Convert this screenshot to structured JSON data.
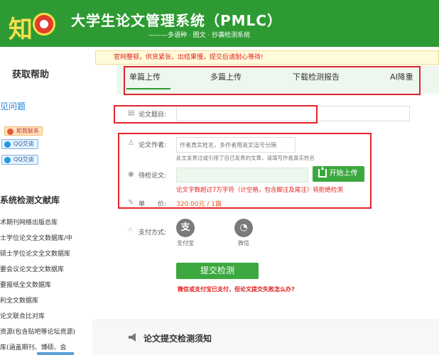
{
  "header": {
    "logo_text": "知",
    "title": "大学生论文管理系统（PMLC）",
    "subtitle": "———多语种 · 图文 · 抄袭检测系统"
  },
  "sidebar": {
    "help_title": "获取帮助",
    "faq_link": "见问题",
    "contact_badge": "和我联系",
    "qq_buttons": [
      "QQ交谈",
      "QQ交谈"
    ],
    "db_title": "系统检测文献库",
    "db_items": [
      "术期刊网络出版总库",
      "士学位论文全文数据库/中",
      "硕士学位论文全文数据库",
      "要会议论文全文数据库",
      "要报纸全文数据库",
      "利全文数据库",
      "论文联合比对库",
      "资源(包含贴吧等论坛资源)",
      "库(涵盖期刊、博硕、会"
    ]
  },
  "main": {
    "notice": "官网整顿，供货紧张，出结果慢，提交后请耐心等待!",
    "tabs": [
      {
        "label": "单篇上传",
        "active": true
      },
      {
        "label": "多篇上传",
        "active": false
      },
      {
        "label": "下载检测报告",
        "active": false
      },
      {
        "label": "AI降重",
        "active": false
      }
    ],
    "form": {
      "title_label": "论文题目:",
      "title_value": "",
      "author_label": "论文作者:",
      "author_placeholder": "作者真实姓名，多作者用英文逗号分隔",
      "author_hint": "此文发表过或引用了自己发表的文章，请填写作者真实姓名",
      "file_label": "待检论文:",
      "upload_button": "开始上传",
      "warning": "论文字数超过7万字符（计空格，包含脚注及尾注）将拒绝检测",
      "price_label": "单　　价:",
      "price_value": "320.00元 / 1篇",
      "payment_label": "支付方式:",
      "payment_methods": [
        {
          "label": "支付宝",
          "glyph": "支",
          "icon": "alipay-icon"
        },
        {
          "label": "微信",
          "glyph": "◔",
          "icon": "wechat-icon"
        }
      ],
      "submit_button": "提交检测",
      "submit_help": "微信或支付宝已支付，但论文提交失败怎么办?"
    },
    "notes_title": "论文提交检测须知"
  },
  "colors": {
    "brand_green": "#2e9a33",
    "button_green": "#3ca83f",
    "alert_red": "#e0201c",
    "annotation_red": "#e5232b"
  }
}
